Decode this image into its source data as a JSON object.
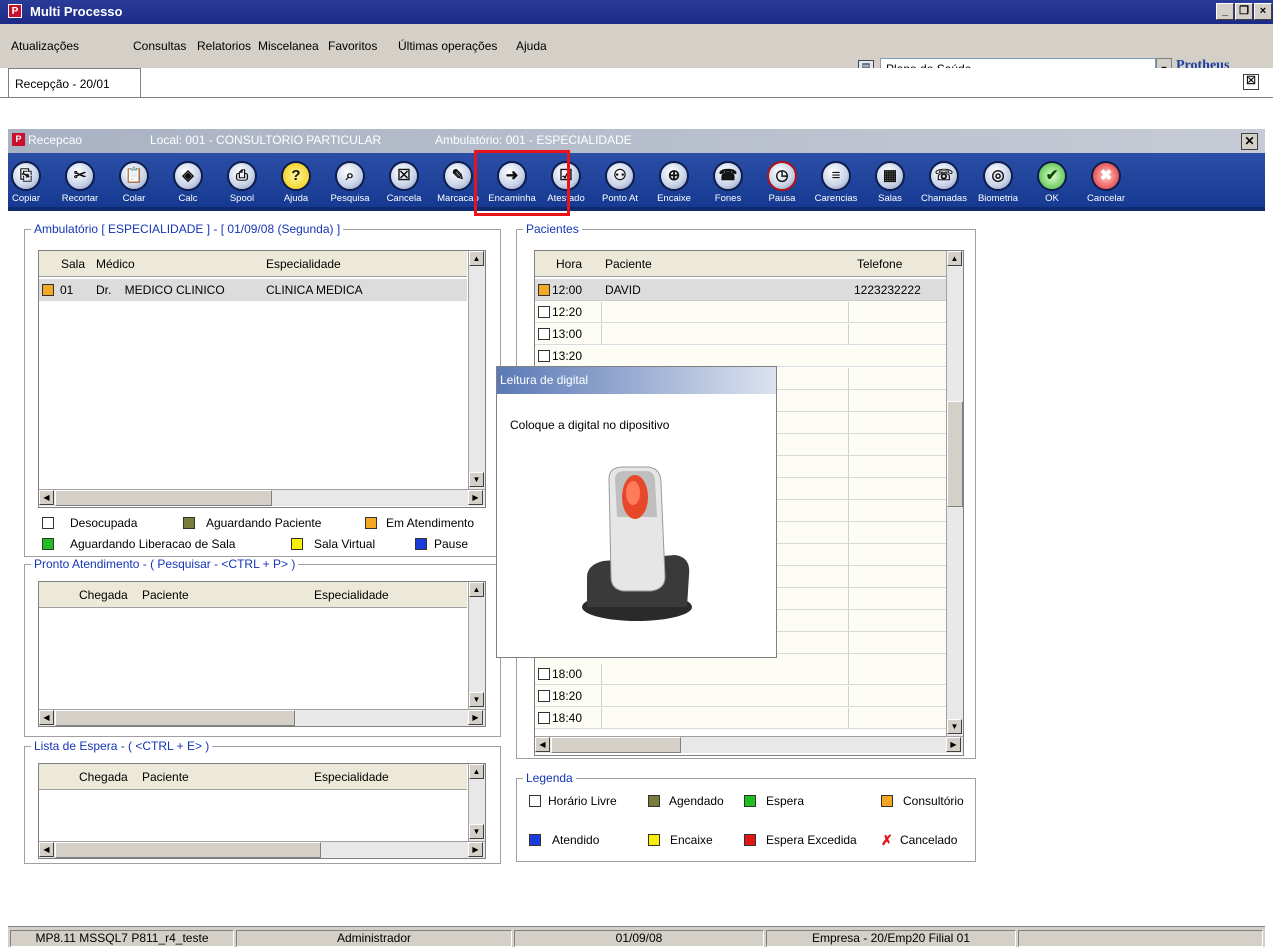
{
  "titlebar": {
    "title": "Multi Processo",
    "app_icon": "P"
  },
  "menu": [
    "Atualizações",
    "Consultas",
    "Relatorios",
    "Miscelanea",
    "Favoritos",
    "Últimas operações",
    "Ajuda"
  ],
  "plan_field": {
    "value": "Plano de Saúde"
  },
  "brand": "Protheus",
  "tab": {
    "label": "Recepção - 20/01"
  },
  "recepcao_bar": {
    "title": "Recepcao",
    "local": "Local: 001 - CONSULTORIO PARTICULAR",
    "ambulatorio": "Ambulatório: 001 - ESPECIALIDADE"
  },
  "toolbar": [
    {
      "label": "Copiar",
      "icon": "copy-icon",
      "glyph": "⎘"
    },
    {
      "label": "Recortar",
      "icon": "scissors-icon",
      "glyph": "✂"
    },
    {
      "label": "Colar",
      "icon": "clipboard-icon",
      "glyph": "📋"
    },
    {
      "label": "Calc",
      "icon": "calculator-icon",
      "glyph": "◈"
    },
    {
      "label": "Spool",
      "icon": "printer-icon",
      "glyph": "⎙"
    },
    {
      "label": "Ajuda",
      "icon": "help-icon",
      "glyph": "?"
    },
    {
      "label": "Pesquisa",
      "icon": "magnifier-icon",
      "glyph": "⌕"
    },
    {
      "label": "Cancela",
      "icon": "cancel-box-icon",
      "glyph": "☒"
    },
    {
      "label": "Marcacao",
      "icon": "marker-icon",
      "glyph": "✎"
    },
    {
      "label": "Encaminha",
      "icon": "forward-icon",
      "glyph": "➜"
    },
    {
      "label": "Atestado",
      "icon": "checklist-icon",
      "glyph": "☑"
    },
    {
      "label": "Ponto At",
      "icon": "people-icon",
      "glyph": "⚇"
    },
    {
      "label": "Encaixe",
      "icon": "insert-icon",
      "glyph": "⊕"
    },
    {
      "label": "Fones",
      "icon": "phone-icon",
      "glyph": "☎"
    },
    {
      "label": "Pausa",
      "icon": "clock-icon",
      "glyph": "◷"
    },
    {
      "label": "Carencias",
      "icon": "list-icon",
      "glyph": "≡"
    },
    {
      "label": "Salas",
      "icon": "rooms-icon",
      "glyph": "▦"
    },
    {
      "label": "Chamadas",
      "icon": "call-icon",
      "glyph": "☏"
    },
    {
      "label": "Biometria",
      "icon": "target-icon",
      "glyph": "◎"
    },
    {
      "label": "OK",
      "icon": "check-icon",
      "glyph": "✔"
    },
    {
      "label": "Cancelar",
      "icon": "cross-icon",
      "glyph": "✖"
    }
  ],
  "ambulatorio_group": {
    "title": "Ambulatório [ ESPECIALIDADE ]   -    [ 01/09/08 (Segunda) ]",
    "headers": [
      "Sala",
      "Médico",
      "Especialidade"
    ],
    "rows": [
      {
        "sala": "01",
        "medico": "Dr.    MEDICO CLINICO",
        "especialidade": "CLINICA MEDICA"
      }
    ],
    "legend": [
      {
        "label": "Desocupada",
        "color": "#ffffff"
      },
      {
        "label": "Aguardando Paciente",
        "color": "#7a7a3a"
      },
      {
        "label": "Em Atendimento",
        "color": "#f5a623"
      },
      {
        "label": "Aguardando Liberacao de Sala",
        "color": "#1fbf1f"
      },
      {
        "label": "Sala Virtual",
        "color": "#f8f000"
      },
      {
        "label": "Pause",
        "color": "#1a3cd8"
      }
    ]
  },
  "pronto_group": {
    "title": "Pronto Atendimento - ( Pesquisar - <CTRL + P> )",
    "headers": [
      "Chegada",
      "Paciente",
      "Especialidade"
    ]
  },
  "espera_group": {
    "title": "Lista de Espera - ( <CTRL + E> )",
    "headers": [
      "Chegada",
      "Paciente",
      "Especialidade"
    ]
  },
  "pacientes_group": {
    "title": "Pacientes",
    "headers": [
      "Hora",
      "Paciente",
      "Telefone"
    ],
    "rows": [
      {
        "hora": "12:00",
        "paciente": "DAVID",
        "telefone": "1223232222"
      },
      {
        "hora": "12:20",
        "paciente": "",
        "telefone": ""
      },
      {
        "hora": "13:00",
        "paciente": "",
        "telefone": ""
      },
      {
        "hora": "13:20",
        "paciente": "",
        "telefone": ""
      },
      {
        "hora": "18:00",
        "paciente": "",
        "telefone": ""
      },
      {
        "hora": "18:20",
        "paciente": "",
        "telefone": ""
      },
      {
        "hora": "18:40",
        "paciente": "",
        "telefone": ""
      }
    ]
  },
  "legenda_group": {
    "title": "Legenda",
    "items": [
      {
        "label": "Horário Livre",
        "color": "#ffffff"
      },
      {
        "label": "Agendado",
        "color": "#7a7a3a"
      },
      {
        "label": "Espera",
        "color": "#1fbf1f"
      },
      {
        "label": "Consultório",
        "color": "#f5a623"
      },
      {
        "label": "Atendido",
        "color": "#1a3cd8"
      },
      {
        "label": "Encaixe",
        "color": "#f8f000"
      },
      {
        "label": "Espera Excedida",
        "color": "#e01414"
      },
      {
        "label": "Cancelado",
        "color": "#e01414"
      }
    ]
  },
  "popup": {
    "title": "Leitura de digital",
    "message": "Coloque a digital no dipositivo"
  },
  "statusbar": [
    "MP8.11  MSSQL7 P811_r4_teste",
    "Administrador",
    "01/09/08",
    "Empresa - 20/Emp20 Filial 01"
  ]
}
